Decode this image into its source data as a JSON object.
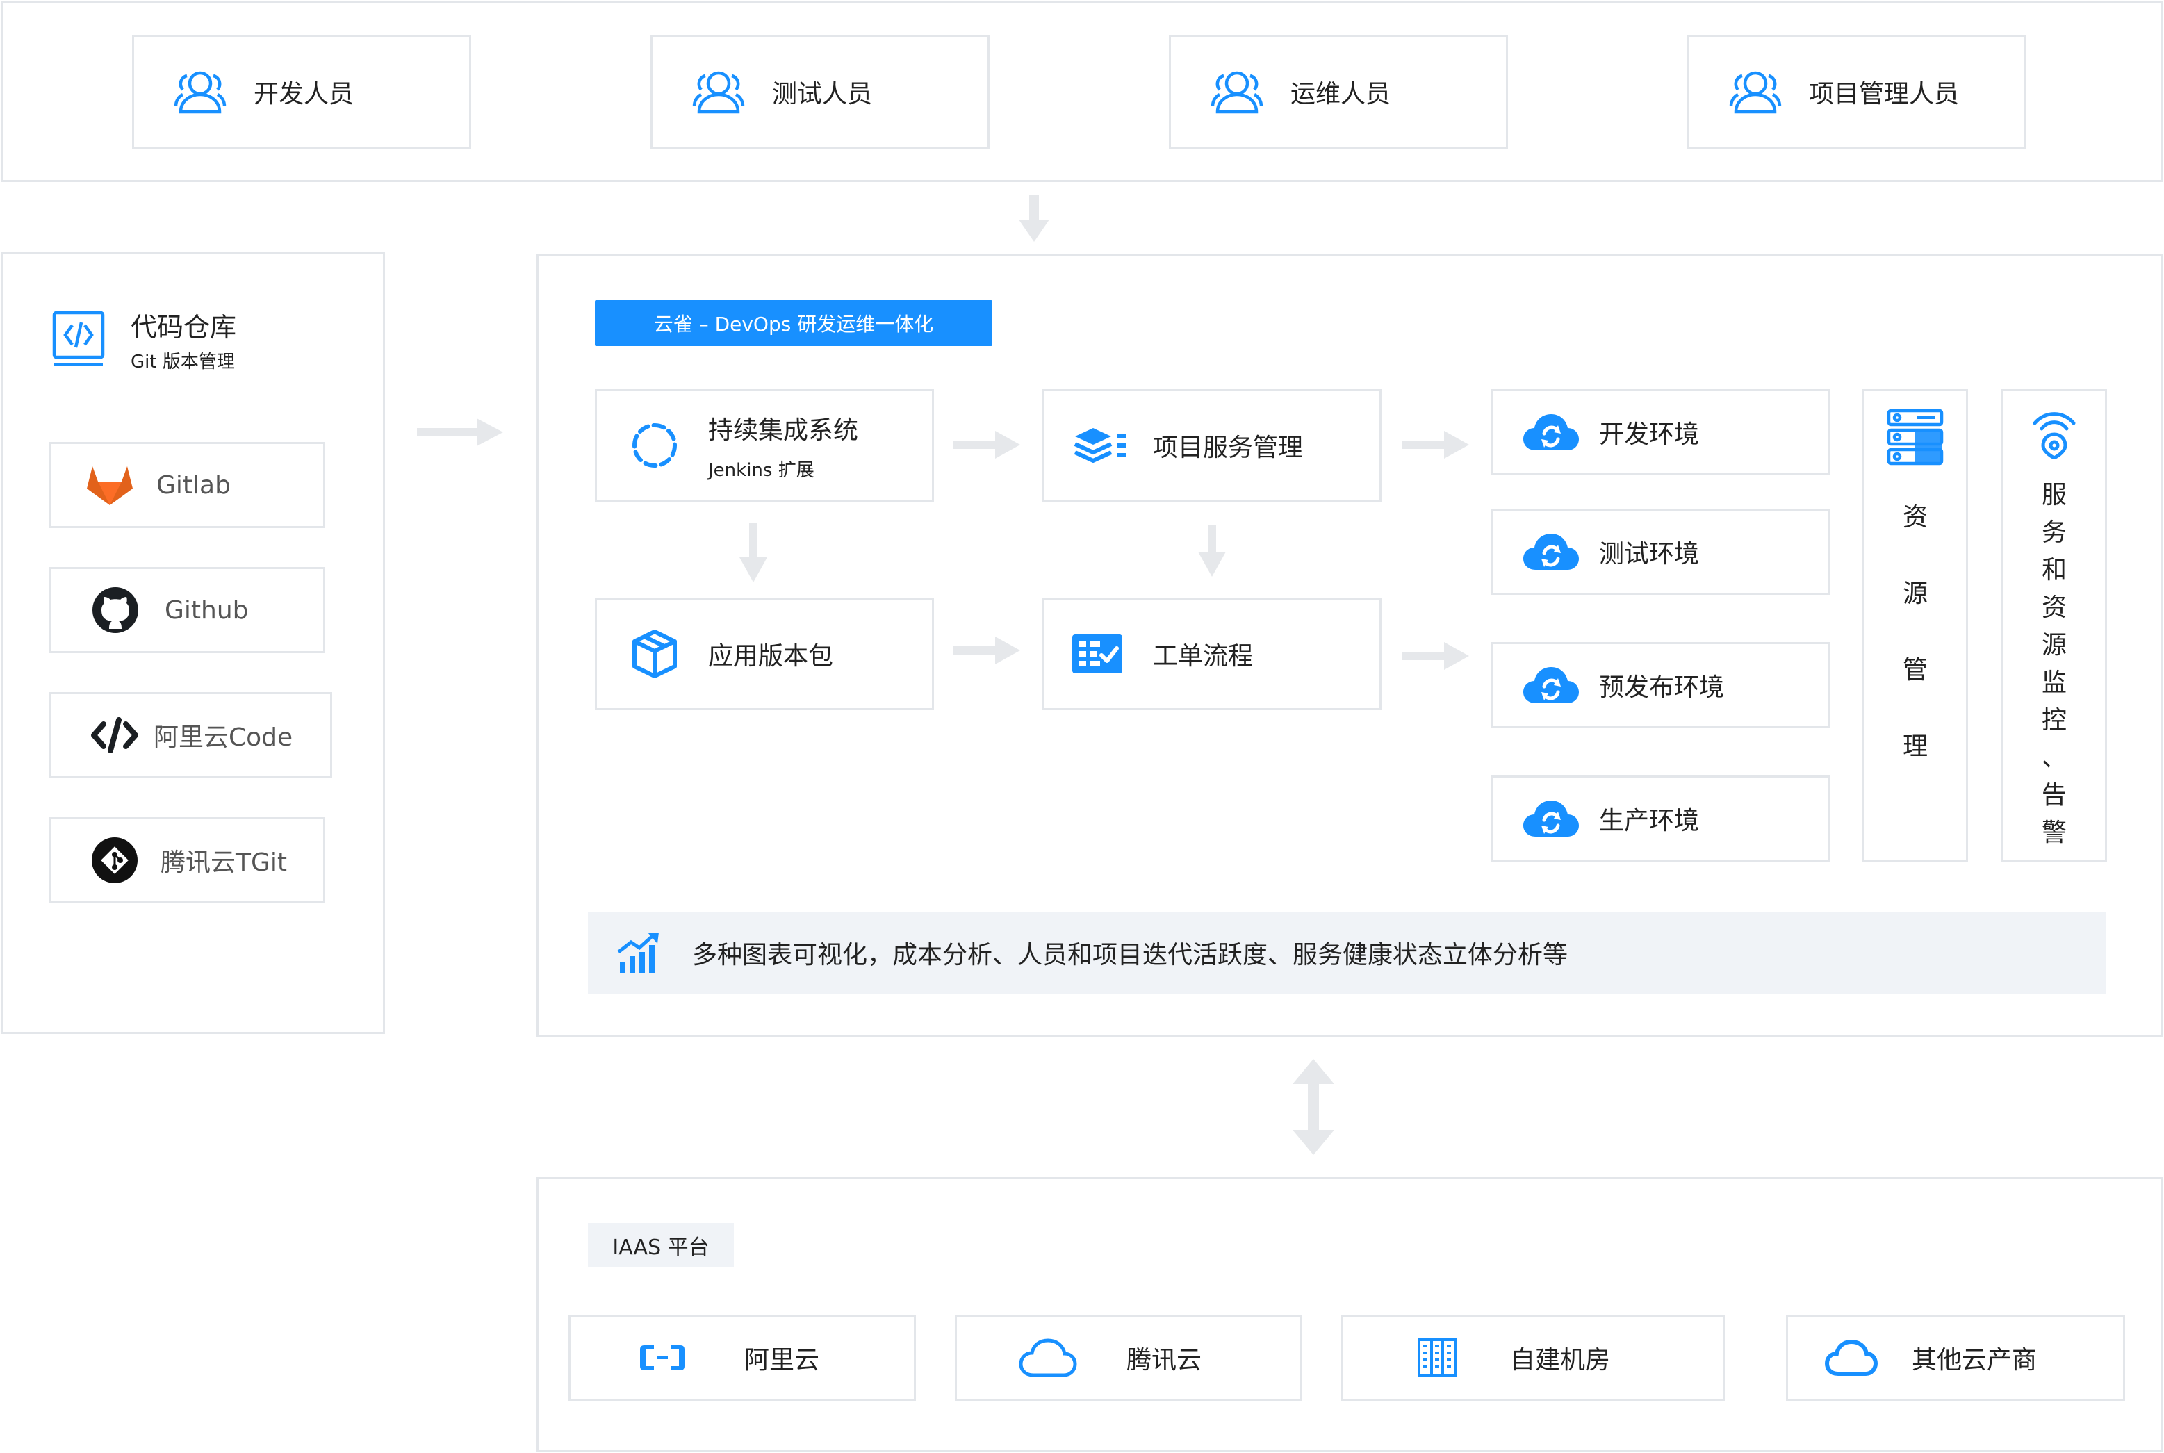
{
  "roles": [
    "开发人员",
    "测试人员",
    "运维人员",
    "项目管理人员"
  ],
  "repo": {
    "title": "代码仓库",
    "subtitle": "Git 版本管理",
    "items": [
      "Gitlab",
      "Github",
      "阿里云Code",
      "腾讯云TGit"
    ]
  },
  "devops": {
    "badge": "云雀 – DevOps 研发运维一体化",
    "ci_title": "持续集成系统",
    "ci_sub": "Jenkins 扩展",
    "package": "应用版本包",
    "project_service": "项目服务管理",
    "workorder": "工单流程",
    "environments": [
      "开发环境",
      "测试环境",
      "预发布环境",
      "生产环境"
    ],
    "resource_mgmt": [
      "资",
      "源",
      "管",
      "理"
    ],
    "monitor": [
      "服",
      "务",
      "和",
      "资",
      "源",
      "监",
      "控",
      "、",
      "告",
      "警"
    ],
    "analytics": "多种图表可视化，成本分析、人员和项目迭代活跃度、服务健康状态立体分析等"
  },
  "iaas": {
    "badge": "IAAS 平台",
    "providers": [
      "阿里云",
      "腾讯云",
      "自建机房",
      "其他云产商"
    ]
  },
  "colors": {
    "accent": "#1890ff",
    "border": "#e3e6ea",
    "arrow": "#e6e8eb",
    "gitlab": "#e2621b",
    "badge_bg": "#f0f3f7"
  },
  "icons": {
    "role": "user-group-icon",
    "code": "code-window-icon",
    "gitlab": "gitlab-fox-icon",
    "github": "github-cat-icon",
    "aliyun_code": "code-brackets-icon",
    "tgit": "git-diamond-icon",
    "ci": "refresh-circle-icon",
    "package": "cube-icon",
    "project": "layers-list-icon",
    "workorder": "checklist-icon",
    "env": "cloud-sync-icon",
    "resource": "server-stack-icon",
    "monitor": "signal-pin-icon",
    "analytics": "bar-trend-icon",
    "aliyun": "aliyun-logo-icon",
    "tencent": "cloud-outline-icon",
    "idc": "server-rack-icon",
    "other_cloud": "cloud-icon"
  }
}
